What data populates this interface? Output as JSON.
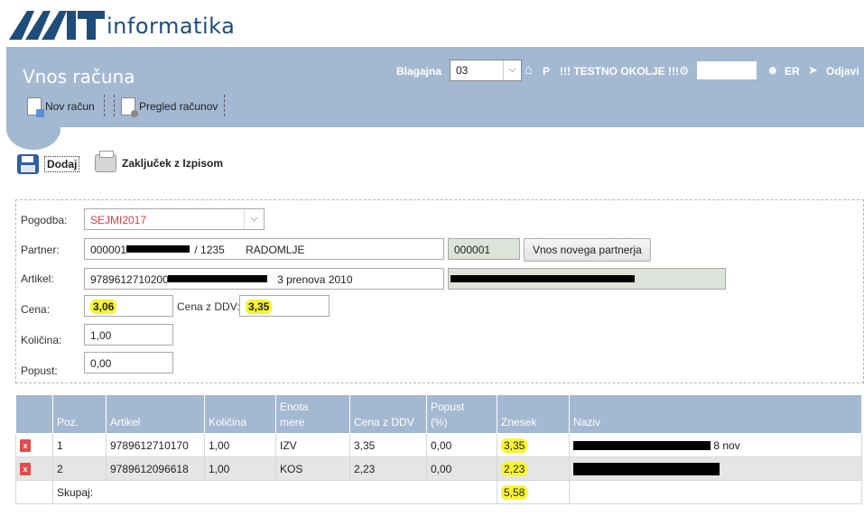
{
  "brand": {
    "logo_text": "informatika",
    "logo_mark": "MIT"
  },
  "header": {
    "title": "Vnos računa",
    "toolbar": {
      "new_invoice": "Nov račun",
      "invoice_overview": "Pregled računov"
    },
    "register_label": "Blagajna",
    "register_value": "03",
    "home_label": "P",
    "env_label": "!!! TESTNO OKOLJE !!!",
    "user_initials": "ER",
    "logout": "Odjavi"
  },
  "actions": {
    "add": "Dodaj",
    "close_print": "Zaključek z Izpisom"
  },
  "form": {
    "contract_label": "Pogodba:",
    "contract_value": "SEJMI2017",
    "partner_label": "Partner:",
    "partner_code": "000001",
    "partner_suffix": "/ 1235",
    "partner_city": "RADOMLJE",
    "partner_id": "000001",
    "new_partner_button": "Vnos novega partnerja",
    "article_label": "Artikel:",
    "article_code": "9789612710200",
    "article_suffix": "3 prenova 2010",
    "price_label": "Cena:",
    "price_value": "3,06",
    "price_vat_label": "Cena z DDV:",
    "price_vat_value": "3,35",
    "quantity_label": "Količina:",
    "quantity_value": "1,00",
    "discount_label": "Popust:",
    "discount_value": "0,00"
  },
  "table": {
    "headers": {
      "pos": "Poz.",
      "article": "Artikel",
      "quantity": "Količina",
      "unit_line1": "Enota",
      "unit_line2": "mere",
      "price_vat": "Cena z DDV",
      "discount_line1": "Popust",
      "discount_line2": "(%)",
      "amount": "Znesek",
      "name": "Naziv"
    },
    "rows": [
      {
        "pos": "1",
        "article": "9789612710170",
        "quantity": "1,00",
        "unit": "IZV",
        "price_vat": "3,35",
        "discount": "0,00",
        "amount": "3,35",
        "name_suffix": "8 nov"
      },
      {
        "pos": "2",
        "article": "9789612096618",
        "quantity": "1,00",
        "unit": "KOS",
        "price_vat": "2,23",
        "discount": "0,00",
        "amount": "2,23",
        "name_suffix": ""
      }
    ],
    "total_label": "Skupaj:",
    "total_value": "5,58"
  },
  "colors": {
    "header_bg": "#a3b8d1",
    "highlight": "#f8f531",
    "delete_icon": "#e34c4c",
    "brand": "#1f4d7a"
  }
}
